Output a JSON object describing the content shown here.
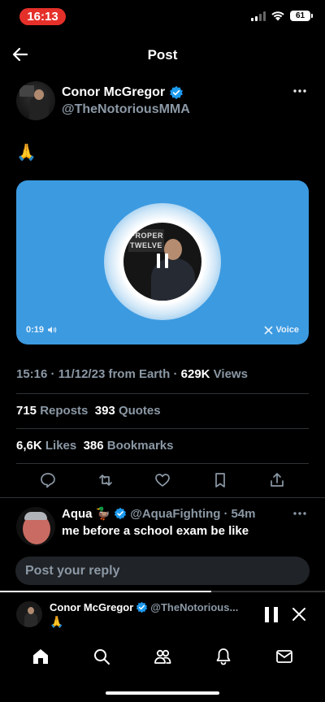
{
  "status_bar": {
    "time": "16:13",
    "battery": "61"
  },
  "header": {
    "title": "Post"
  },
  "post": {
    "author_name": "Conor McGregor",
    "author_handle": "@TheNotoriousMMA",
    "text": "🙏",
    "voice": {
      "duration": "0:19",
      "brand": "Voice",
      "avatar_sign_text": "PROPER\nTWELVE"
    },
    "time": "15:16",
    "date": "11/12/23",
    "source": "from Earth",
    "views_count": "629K",
    "views_label": "Views"
  },
  "stats": {
    "reposts_count": "715",
    "reposts_label": "Reposts",
    "quotes_count": "393",
    "quotes_label": "Quotes",
    "likes_count": "6,6K",
    "likes_label": "Likes",
    "bookmarks_count": "386",
    "bookmarks_label": "Bookmarks"
  },
  "reply": {
    "name": "Aqua",
    "emoji": "🦆",
    "handle": "@AquaFighting",
    "time": "54m",
    "text": "me before a school exam be like"
  },
  "reply_input": {
    "placeholder": "Post your reply"
  },
  "mini_player": {
    "name": "Conor McGregor",
    "handle": "@TheNotorious...",
    "subtitle": "🙏",
    "progress": 0.65
  },
  "tabs": [
    "home-icon",
    "search-icon",
    "communities-icon",
    "notifications-icon",
    "messages-icon"
  ],
  "colors": {
    "accent": "#1d9bf0",
    "voice_card": "#3c9ae0",
    "time_pill": "#e5302a",
    "muted": "#8b98a5"
  }
}
